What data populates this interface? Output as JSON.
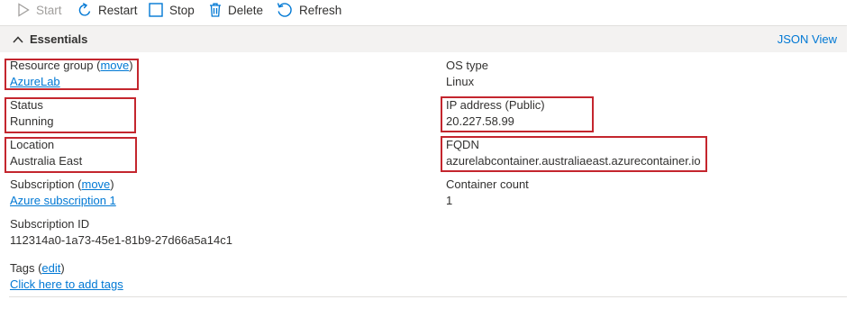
{
  "toolbar": {
    "start": "Start",
    "restart": "Restart",
    "stop": "Stop",
    "delete": "Delete",
    "refresh": "Refresh"
  },
  "essentials": {
    "title": "Essentials",
    "json_view": "JSON View"
  },
  "properties": {
    "resource_group": {
      "label": "Resource group (",
      "link": "move",
      "close": ")",
      "value": "AzureLab"
    },
    "status": {
      "label": "Status",
      "value": "Running"
    },
    "location": {
      "label": "Location",
      "value": "Australia East"
    },
    "subscription": {
      "label": "Subscription (",
      "link": "move",
      "close": ")",
      "value": "Azure subscription 1"
    },
    "subscription_id": {
      "label": "Subscription ID",
      "value": "112314a0-1a73-45e1-81b9-27d66a5a14c1"
    },
    "os_type": {
      "label": "OS type",
      "value": "Linux"
    },
    "ip_address": {
      "label": "IP address (Public)",
      "value": "20.227.58.99"
    },
    "fqdn": {
      "label": "FQDN",
      "value": "azurelabcontainer.australiaeast.azurecontainer.io"
    },
    "container_count": {
      "label": "Container count",
      "value": "1"
    },
    "tags": {
      "label": "Tags (",
      "link": "edit",
      "close": ")",
      "value": "Click here to add tags"
    }
  },
  "colors": {
    "link": "#0078d4",
    "highlight": "#c4262e",
    "header_bg": "#f3f2f1"
  }
}
